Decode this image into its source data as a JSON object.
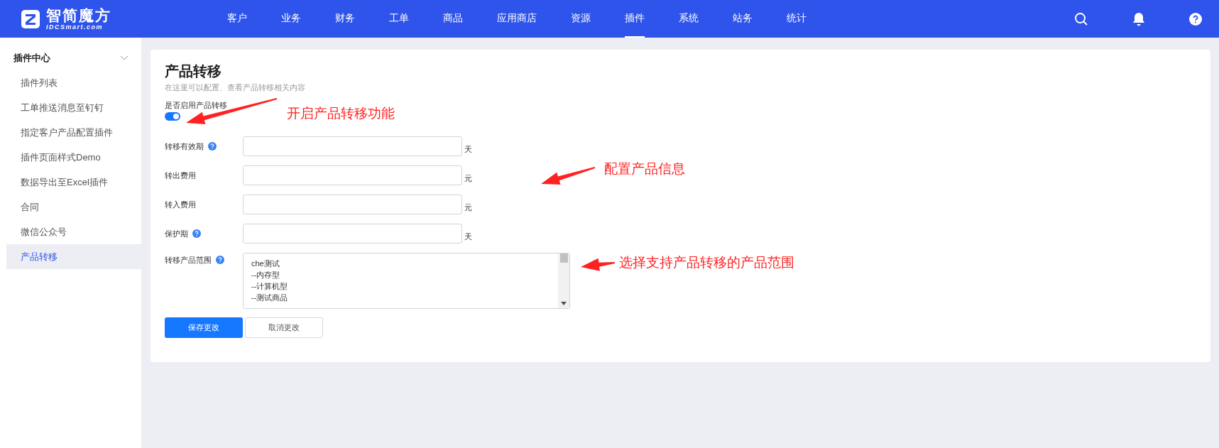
{
  "logo": {
    "name": "智简魔方",
    "domain": "IDCSmart.com"
  },
  "nav": [
    {
      "label": "客户",
      "selected": false
    },
    {
      "label": "业务",
      "selected": false
    },
    {
      "label": "财务",
      "selected": false
    },
    {
      "label": "工单",
      "selected": false
    },
    {
      "label": "商品",
      "selected": false
    },
    {
      "label": "应用商店",
      "selected": false
    },
    {
      "label": "资源",
      "selected": false
    },
    {
      "label": "插件",
      "selected": true
    },
    {
      "label": "系统",
      "selected": false
    },
    {
      "label": "站务",
      "selected": false
    },
    {
      "label": "统计",
      "selected": false
    }
  ],
  "sidebar": {
    "group": {
      "label": "插件中心",
      "expanded": true
    },
    "items": [
      {
        "label": "插件列表",
        "selected": false
      },
      {
        "label": "工单推送消息至钉钉",
        "selected": false
      },
      {
        "label": "指定客户产品配置插件",
        "selected": false
      },
      {
        "label": "插件页面样式Demo",
        "selected": false
      },
      {
        "label": "数据导出至Excel插件",
        "selected": false
      },
      {
        "label": "合同",
        "selected": false
      },
      {
        "label": "微信公众号",
        "selected": false
      },
      {
        "label": "产品转移",
        "selected": true
      }
    ]
  },
  "page": {
    "title": "产品转移",
    "subtitle": "在这里可以配置、查看产品转移相关内容"
  },
  "toggle": {
    "label": "是否启用产品转移",
    "on": true
  },
  "fields": [
    {
      "label": "转移有效期",
      "help": true,
      "unit": "天"
    },
    {
      "label": "转出费用",
      "help": false,
      "unit": "元"
    },
    {
      "label": "转入费用",
      "help": false,
      "unit": "元"
    },
    {
      "label": "保护期",
      "help": true,
      "unit": "天"
    }
  ],
  "scope": {
    "label": "转移产品范围",
    "help": true,
    "options": [
      "che测试",
      "--内存型",
      "--计算机型",
      "--测试商品"
    ]
  },
  "buttons": {
    "save": "保存更改",
    "cancel": "取消更改"
  },
  "annotations": [
    "开启产品转移功能",
    "配置产品信息",
    "选择支持产品转移的产品范围"
  ]
}
